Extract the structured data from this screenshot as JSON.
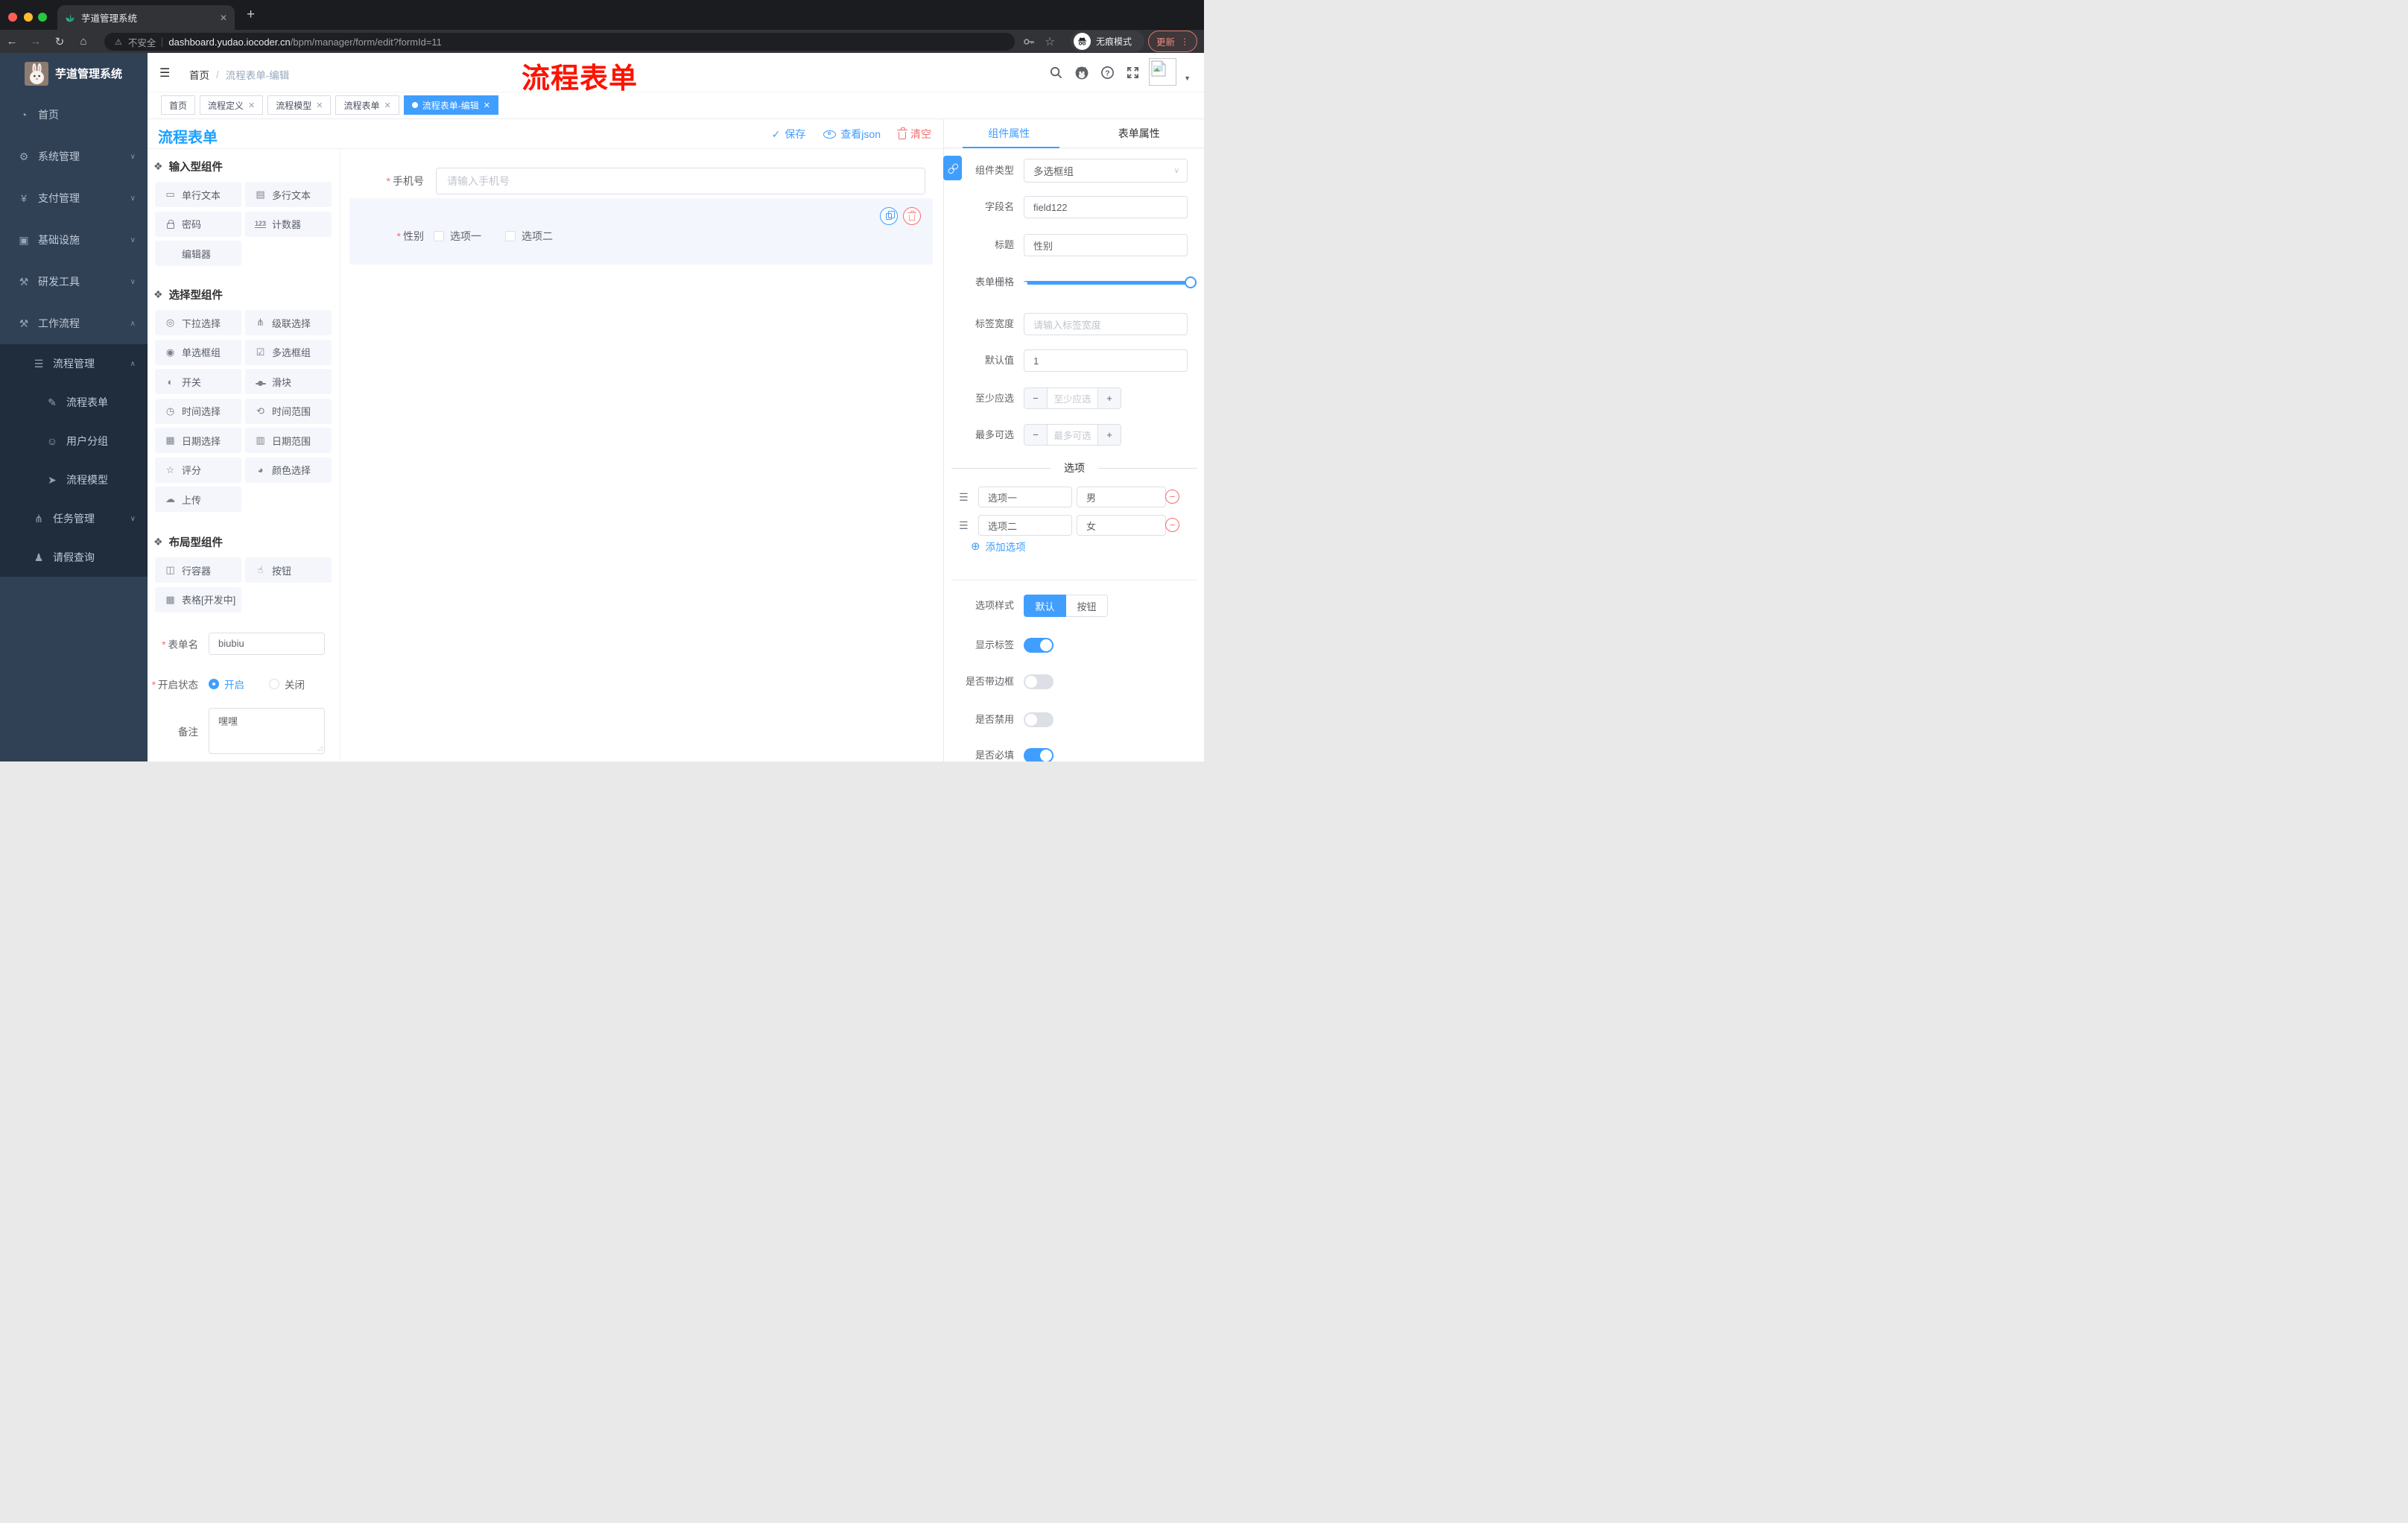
{
  "colors": {
    "accent": "#409eff",
    "danger": "#f56c6c",
    "title_blue": "#1ba0ff",
    "sidebar_bg": "#304156",
    "submenu_bg": "#1f2d3d",
    "annotation_red": "#ff1200"
  },
  "icons": {
    "gauge": "◔",
    "gear": "⚙",
    "yen": "¥",
    "monitor": "▣",
    "toolbox": "⚒",
    "list": "☰",
    "doc-edit": "✎",
    "face": "☺",
    "plane": "➤",
    "tree": "⋔",
    "person": "♟",
    "puzzle": "❖",
    "input": "▭",
    "textarea": "▤",
    "lock": "css:lock",
    "counter": "txt:123",
    "none": "",
    "select": "◎",
    "cascade": "⋔",
    "radio": "◉",
    "checkbox": "☑",
    "switch": "◐",
    "slider": "css:sliderico",
    "time": "◷",
    "time-range": "⟲",
    "date": "▦",
    "date-range": "▥",
    "rate": "☆",
    "color": "◕",
    "upload": "☁",
    "row": "◫",
    "button": "☝",
    "table": "▦",
    "chevron-down": "∨",
    "chevron-up": "∧"
  },
  "browser": {
    "tab_title": "芋道管理系统",
    "close_tab": "✕",
    "new_tab": "+",
    "security_label": "不安全",
    "url_host": "dashboard.yudao.iocoder.cn",
    "url_path": "/bpm/manager/form/edit?formId=11",
    "incognito_label": "无痕模式",
    "update_label": "更新",
    "menu_dots": "⋮",
    "back": "←",
    "forward": "→",
    "reload": "↻",
    "home": "⌂",
    "warning": "⚠",
    "star": "☆"
  },
  "annotation": {
    "text": "流程表单"
  },
  "sidebar": {
    "logo_title": "芋道管理系统",
    "items": [
      {
        "label": "首页",
        "icon": "gauge",
        "level": 1,
        "arrow": "",
        "submenu": false
      },
      {
        "label": "系统管理",
        "icon": "gear",
        "level": 1,
        "arrow": "down",
        "submenu": false
      },
      {
        "label": "支付管理",
        "icon": "yen",
        "level": 1,
        "arrow": "down",
        "submenu": false
      },
      {
        "label": "基础设施",
        "icon": "monitor",
        "level": 1,
        "arrow": "down",
        "submenu": false
      },
      {
        "label": "研发工具",
        "icon": "toolbox",
        "level": 1,
        "arrow": "down",
        "submenu": false
      },
      {
        "label": "工作流程",
        "icon": "toolbox",
        "level": 1,
        "arrow": "up",
        "submenu": false
      },
      {
        "label": "流程管理",
        "icon": "list",
        "level": 2,
        "arrow": "up",
        "submenu": true
      },
      {
        "label": "流程表单",
        "icon": "doc-edit",
        "level": 3,
        "arrow": "",
        "submenu": true
      },
      {
        "label": "用户分组",
        "icon": "face",
        "level": 3,
        "arrow": "",
        "submenu": true
      },
      {
        "label": "流程模型",
        "icon": "plane",
        "level": 3,
        "arrow": "",
        "submenu": true
      },
      {
        "label": "任务管理",
        "icon": "tree",
        "level": 2,
        "arrow": "down",
        "submenu": true
      },
      {
        "label": "请假查询",
        "icon": "person",
        "level": 2,
        "arrow": "",
        "submenu": true
      }
    ]
  },
  "header": {
    "breadcrumb": [
      "首页",
      "流程表单-编辑"
    ]
  },
  "tags": [
    {
      "label": "首页",
      "closable": false,
      "active": false
    },
    {
      "label": "流程定义",
      "closable": true,
      "active": false
    },
    {
      "label": "流程模型",
      "closable": true,
      "active": false
    },
    {
      "label": "流程表单",
      "closable": true,
      "active": false
    },
    {
      "label": "流程表单-编辑",
      "closable": true,
      "active": true
    }
  ],
  "designer": {
    "title": "流程表单",
    "actions": {
      "save": "保存",
      "view_json": "查看json",
      "clear": "清空"
    }
  },
  "palette": {
    "sections": [
      {
        "title": "输入型组件",
        "items": [
          {
            "label": "单行文本",
            "icon": "input"
          },
          {
            "label": "多行文本",
            "icon": "textarea"
          },
          {
            "label": "密码",
            "icon": "lock"
          },
          {
            "label": "计数器",
            "icon": "counter"
          },
          {
            "label": "编辑器",
            "icon": "none"
          }
        ]
      },
      {
        "title": "选择型组件",
        "items": [
          {
            "label": "下拉选择",
            "icon": "select"
          },
          {
            "label": "级联选择",
            "icon": "cascade"
          },
          {
            "label": "单选框组",
            "icon": "radio"
          },
          {
            "label": "多选框组",
            "icon": "checkbox"
          },
          {
            "label": "开关",
            "icon": "switch"
          },
          {
            "label": "滑块",
            "icon": "slider"
          },
          {
            "label": "时间选择",
            "icon": "time"
          },
          {
            "label": "时间范围",
            "icon": "time-range"
          },
          {
            "label": "日期选择",
            "icon": "date"
          },
          {
            "label": "日期范围",
            "icon": "date-range"
          },
          {
            "label": "评分",
            "icon": "rate"
          },
          {
            "label": "颜色选择",
            "icon": "color"
          },
          {
            "label": "上传",
            "icon": "upload"
          }
        ]
      },
      {
        "title": "布局型组件",
        "items": [
          {
            "label": "行容器",
            "icon": "row"
          },
          {
            "label": "按钮",
            "icon": "button"
          },
          {
            "label": "表格[开发中]",
            "icon": "table"
          }
        ]
      }
    ]
  },
  "canvas": {
    "phone_field": {
      "label": "手机号",
      "placeholder": "请输入手机号",
      "required": true
    },
    "gender_field": {
      "label": "性别",
      "required": true,
      "options": [
        "选项一",
        "选项二"
      ]
    }
  },
  "form_settings": {
    "name_label": "表单名",
    "name_value": "biubiu",
    "status_label": "开启状态",
    "status_options": [
      "开启",
      "关闭"
    ],
    "status_selected": "开启",
    "remark_label": "备注",
    "remark_value": "嘿嘿"
  },
  "panel": {
    "tabs": [
      "组件属性",
      "表单属性"
    ],
    "active_tab": "组件属性",
    "fields": {
      "component_type": {
        "label": "组件类型",
        "value": "多选框组"
      },
      "field_name": {
        "label": "字段名",
        "value": "field122"
      },
      "title": {
        "label": "标题",
        "value": "性别"
      },
      "grid": {
        "label": "表单栅格"
      },
      "label_width": {
        "label": "标签宽度",
        "placeholder": "请输入标签宽度"
      },
      "default_value": {
        "label": "默认值",
        "value": "1"
      },
      "min_select": {
        "label": "至少应选",
        "placeholder": "至少应选"
      },
      "max_select": {
        "label": "最多可选",
        "placeholder": "最多可选"
      }
    },
    "options_divider": "选项",
    "options": [
      {
        "label": "选项一",
        "value": "男"
      },
      {
        "label": "选项二",
        "value": "女"
      }
    ],
    "add_option": "添加选项",
    "option_style": {
      "label": "选项样式",
      "choices": [
        "默认",
        "按钮"
      ],
      "selected": "默认"
    },
    "toggles": [
      {
        "label": "显示标签",
        "on": true
      },
      {
        "label": "是否带边框",
        "on": false
      },
      {
        "label": "是否禁用",
        "on": false
      },
      {
        "label": "是否必填",
        "on": true
      }
    ]
  }
}
